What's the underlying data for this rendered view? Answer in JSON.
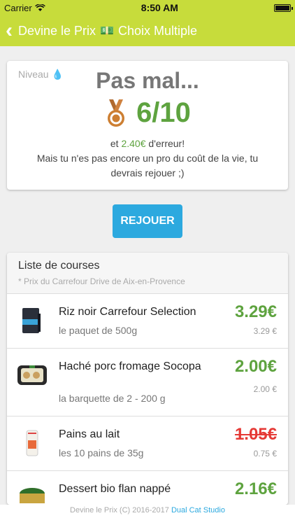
{
  "status": {
    "carrier": "Carrier",
    "time": "8:50 AM"
  },
  "nav": {
    "left": "Devine le Prix",
    "right": "Choix Multiple"
  },
  "result": {
    "level_label": "Niveau",
    "headline": "Pas mal...",
    "score": "6/10",
    "error_prefix": "et",
    "error_amount": "2.40€",
    "error_suffix": "d'erreur!",
    "message": "Mais tu n'es pas encore un pro du coût de la vie, tu devrais rejouer ;)"
  },
  "replay_label": "REJOUER",
  "list": {
    "title": "Liste de courses",
    "subtitle": "* Prix du Carrefour Drive de Aix-en-Provence",
    "items": [
      {
        "name": "Riz noir Carrefour Selection",
        "desc": "le paquet de 500g",
        "price": "3.29€",
        "small": "3.29 €",
        "status": "correct"
      },
      {
        "name": "Haché porc fromage Socopa",
        "desc": "la barquette de 2 - 200 g",
        "price": "2.00€",
        "small": "2.00 €",
        "status": "correct"
      },
      {
        "name": "Pains au lait",
        "desc": "les 10 pains de 35g",
        "price": "1.05€",
        "small": "0.75 €",
        "status": "wrong"
      },
      {
        "name": "Dessert bio flan nappé",
        "price": "2.16€",
        "status": "correct"
      }
    ]
  },
  "footer": {
    "text": "Devine le Prix (C) 2016-2017",
    "studio": "Dual Cat Studio"
  },
  "colors": {
    "header": "#c7dc3b",
    "good": "#5ea33f",
    "bad": "#e53935",
    "button": "#2ca9df"
  }
}
